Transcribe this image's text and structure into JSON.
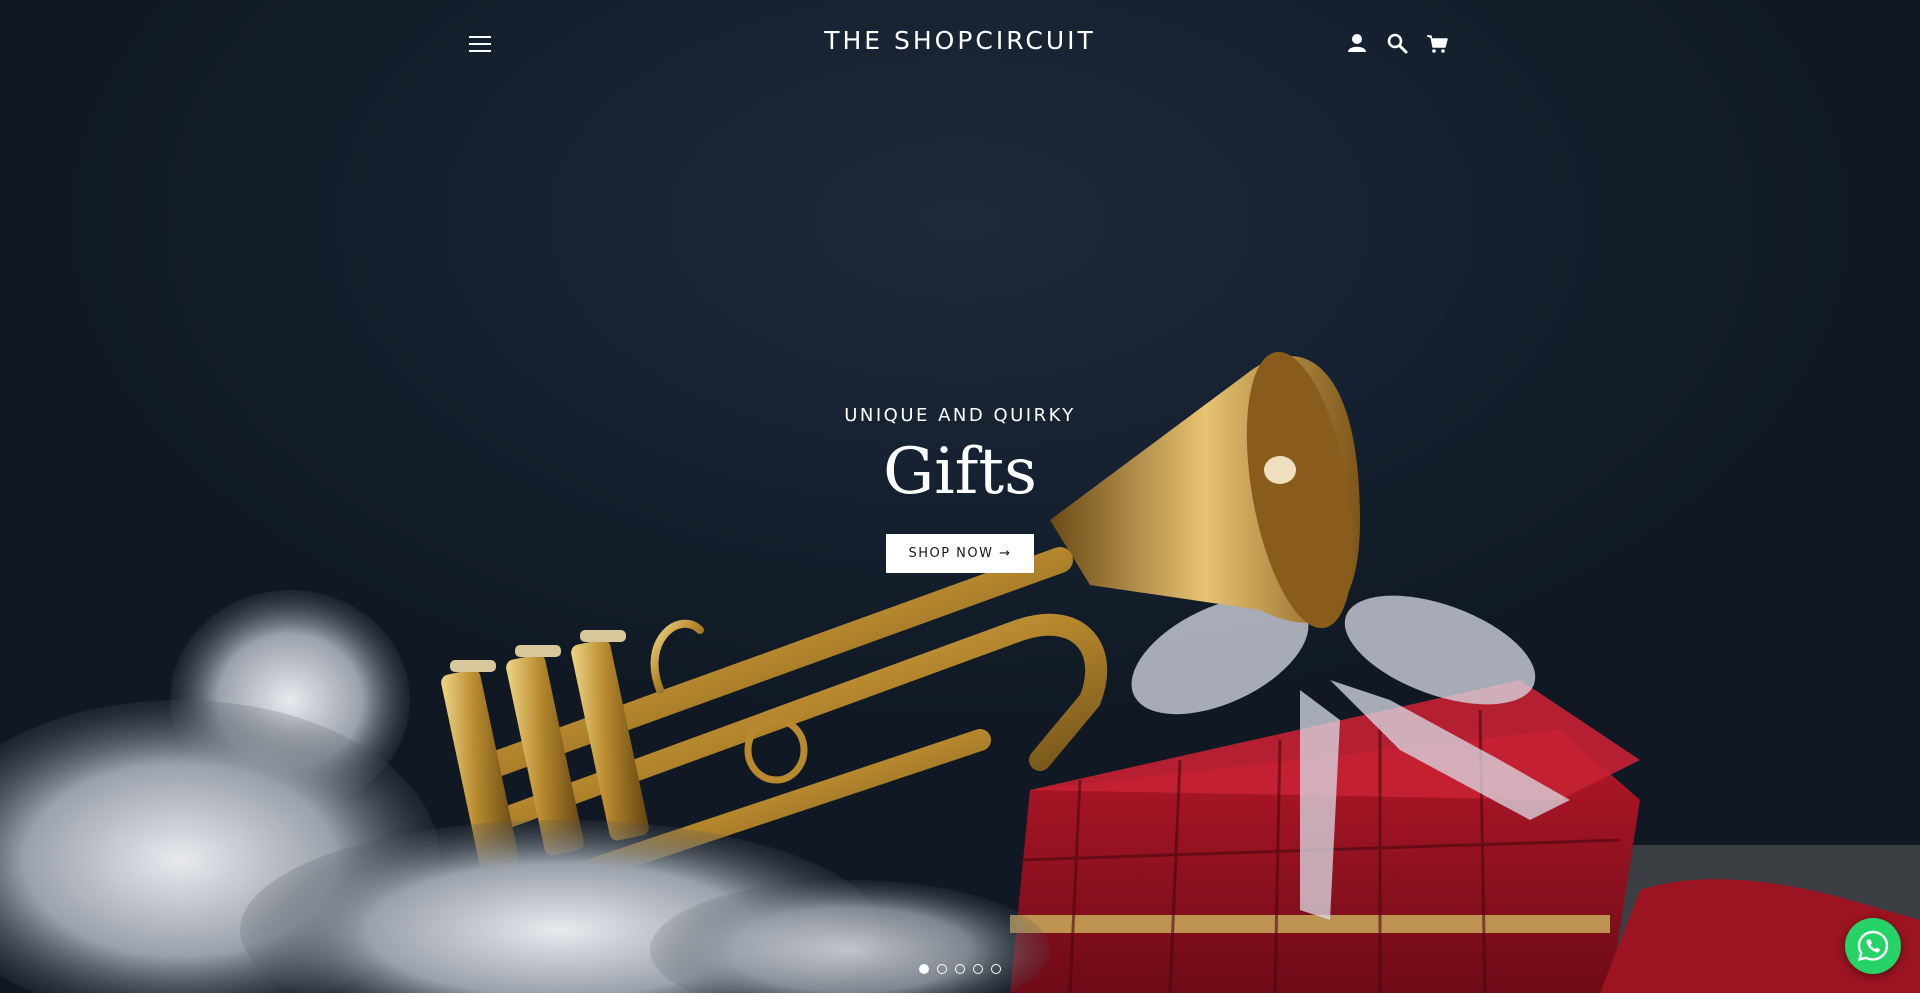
{
  "header": {
    "site_title": "THE SHOPCIRCUIT",
    "icons": {
      "menu": "hamburger-menu-icon",
      "login": "user-icon",
      "search": "search-icon",
      "cart": "cart-icon"
    }
  },
  "hero": {
    "subtitle": "UNIQUE AND QUIRKY",
    "title": "Gifts",
    "button_label": "SHOP NOW →",
    "slides_total": 5,
    "active_slide": 1
  },
  "floating": {
    "whatsapp_icon": "whatsapp-icon"
  },
  "colors": {
    "background": "#16202c",
    "text": "#ffffff",
    "button_bg": "#ffffff",
    "whatsapp": "#25d366"
  }
}
